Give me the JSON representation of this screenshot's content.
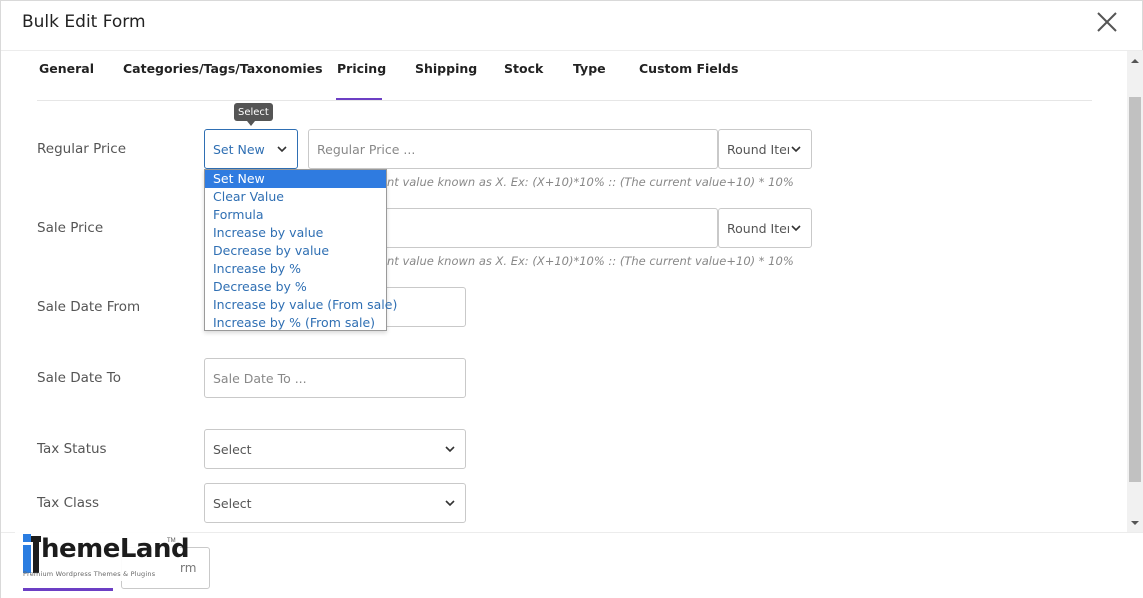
{
  "modal": {
    "title": "Bulk Edit Form"
  },
  "tabs": [
    {
      "label": "General"
    },
    {
      "label": "Categories/Tags/Taxonomies"
    },
    {
      "label": "Pricing"
    },
    {
      "label": "Shipping"
    },
    {
      "label": "Stock"
    },
    {
      "label": "Type"
    },
    {
      "label": "Custom Fields"
    }
  ],
  "active_tab": "Pricing",
  "tooltip": "Select",
  "fields": {
    "regular_price": {
      "label": "Regular Price",
      "operation": "Set New",
      "placeholder": "Regular Price ...",
      "round": "Round Iten",
      "hint": "nt value known as X. Ex: (X+10)*10% :: (The current value+10) * 10%"
    },
    "sale_price": {
      "label": "Sale Price",
      "round": "Round Iten",
      "hint": "nt value known as X. Ex: (X+10)*10% :: (The current value+10) * 10%"
    },
    "sale_date_from": {
      "label": "Sale Date From"
    },
    "sale_date_to": {
      "label": "Sale Date To",
      "placeholder": "Sale Date To ..."
    },
    "tax_status": {
      "label": "Tax Status",
      "value": "Select"
    },
    "tax_class": {
      "label": "Tax Class",
      "value": "Select"
    }
  },
  "dropdown_options": [
    "Set New",
    "Clear Value",
    "Formula",
    "Increase by value",
    "Decrease by value",
    "Increase by %",
    "Decrease by %",
    "Increase by value (From sale)",
    "Increase by % (From sale)"
  ],
  "dropdown_selected": "Set New",
  "footer": {
    "partial_button_label": "rm"
  },
  "logo": {
    "name": "hemeLand",
    "tm": "TM",
    "tagline": "Premium Wordpress Themes & Plugins"
  },
  "colors": {
    "accent": "#6c3fc4",
    "link": "#2f6fb3",
    "selected": "#2f7be0"
  }
}
